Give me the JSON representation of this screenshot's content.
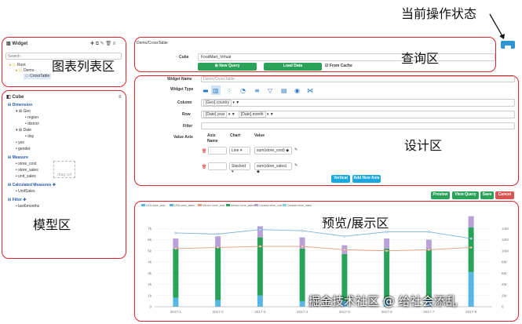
{
  "annotations": {
    "status": "当前操作状态",
    "widget_list": "图表列表区",
    "query": "查询区",
    "design": "设计区",
    "model": "模型区",
    "preview": "预览/展示区"
  },
  "widget_panel": {
    "title": "Widget",
    "search_placeholder": "Search",
    "tree": [
      "Root",
      "Demo",
      "CrossTable"
    ]
  },
  "cube_panel": {
    "title": "Cube",
    "dimension_label": "Dimension",
    "dimensions": [
      "Geo",
      "region",
      "district",
      "Date",
      "day",
      "yes",
      "gender"
    ],
    "measure_label": "Measure",
    "measures": [
      "store_cost",
      "store_sales",
      "unit_sales"
    ],
    "calc_label": "Calculated Measures ✚",
    "calc_measures": [
      "UnitSales"
    ],
    "filter_label": "Filter ✚",
    "filters": [
      "last6months"
    ],
    "drag_hint": "drag col"
  },
  "query_panel": {
    "path": "Demo/CrossTable",
    "cube_label": "Cube",
    "cube_value": "FoodMart_Virtual",
    "new_query": "New Query",
    "load_data": "Load Data",
    "from_cache": "From Cache"
  },
  "design_panel": {
    "widget_name_label": "Widget Name",
    "widget_name_value": "Demo/CrossTable",
    "widget_type_label": "Widget Type",
    "column_label": "Column",
    "column_value": "[Geo].country",
    "row_label": "Row",
    "row_values": [
      "[Date].year",
      "[Date].month"
    ],
    "filter_label": "Filter",
    "value_axis_label": "Value Axis",
    "headers": [
      "Axis Name",
      "Chart",
      "Value"
    ],
    "rows": [
      {
        "chart": "Line",
        "value": "sum(store_cost)"
      },
      {
        "chart": "Stacked",
        "value": "sum(store_sales)"
      }
    ],
    "vertical": "Vertical",
    "add_new_axis": "Add New Axis"
  },
  "action_buttons": {
    "preview": "Preview",
    "view_query": "View Query",
    "save": "Save",
    "cancel": "Cancel"
  },
  "chart_data": {
    "type": "bar",
    "categories": [
      "2017-1",
      "2017-2",
      "2017-3",
      "2017-4",
      "2017-5",
      "2017-6",
      "2017-7",
      "2017-8"
    ],
    "legend": [
      "USA store_cost",
      "USA store_sales",
      "Mexico store_cost",
      "Mexico store_sales",
      "Canada store_cost",
      "Canada store_sales"
    ],
    "series": [
      {
        "name": "USA store_sales",
        "values": [
          0.8,
          0.6,
          1.0,
          0.5,
          0.5,
          0.7,
          0.7,
          3.1
        ]
      },
      {
        "name": "Mexico store_sales",
        "values": [
          4.4,
          4.7,
          5.2,
          4.7,
          4.2,
          4.5,
          4.4,
          4.0
        ]
      },
      {
        "name": "Canada store_sales",
        "values": [
          0.9,
          1.0,
          1.0,
          1.0,
          0.8,
          0.9,
          0.9,
          1.0
        ]
      }
    ],
    "lines": [
      {
        "name": "USA store_cost",
        "values": [
          6.6,
          6.5,
          6.9,
          6.8,
          6.3,
          6.7,
          6.7,
          6.1
        ]
      },
      {
        "name": "Mexico store_cost",
        "values": [
          5.2,
          5.3,
          5.4,
          5.4,
          5.1,
          5.0,
          5.1,
          5.3
        ]
      }
    ],
    "ylim": [
      0,
      8
    ],
    "yticks": [
      "0",
      "1k",
      "2k",
      "3k",
      "4k",
      "5k",
      "6k",
      "7k"
    ],
    "yticks_right": [
      "0",
      "2M",
      "4M",
      "6M",
      "8M",
      "10M",
      "12M",
      "14M"
    ]
  },
  "footer": {
    "watermark": "掘金技术社区 @ 给社会添乱"
  }
}
